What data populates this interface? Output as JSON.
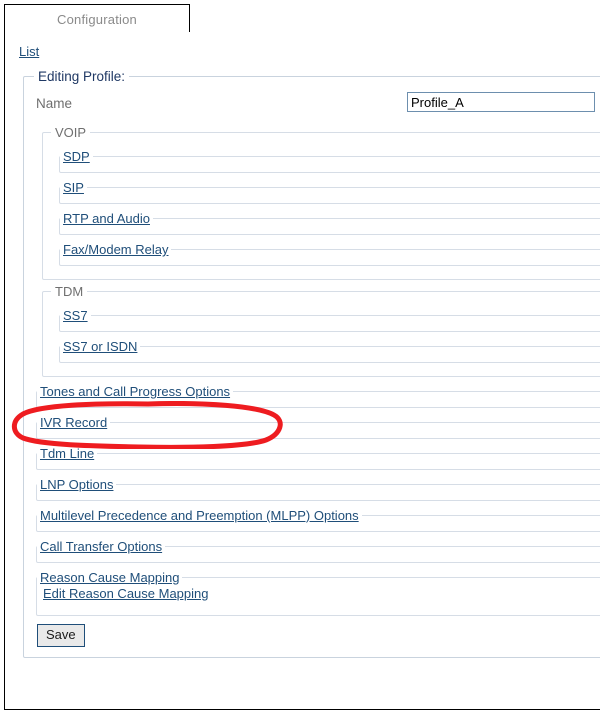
{
  "tab": {
    "label": "Configuration"
  },
  "breadcrumb": {
    "list_label": "List"
  },
  "form": {
    "legend": "Editing Profile:",
    "name_label": "Name",
    "name_value": "Profile_A",
    "name_placeholder": "",
    "save_label": "Save"
  },
  "sections": {
    "voip": {
      "legend": "VOIP",
      "items": [
        {
          "label": "SDP"
        },
        {
          "label": "SIP"
        },
        {
          "label": "RTP and Audio"
        },
        {
          "label": "Fax/Modem Relay"
        }
      ]
    },
    "tdm": {
      "legend": "TDM",
      "items": [
        {
          "label": "SS7"
        },
        {
          "label": "SS7 or ISDN"
        }
      ]
    }
  },
  "top_level_items": [
    {
      "label": "Tones and Call Progress Options"
    },
    {
      "label": "IVR Record"
    },
    {
      "label": "Tdm Line"
    },
    {
      "label": "LNP Options"
    },
    {
      "label": "Multilevel Precedence and Preemption (MLPP) Options"
    },
    {
      "label": "Call Transfer Options"
    }
  ],
  "reason_cause": {
    "legend": "Reason Cause Mapping",
    "edit_label": "Edit Reason Cause Mapping"
  },
  "annotation": {
    "color": "#ee1c20",
    "target": "Tones and Call Progress Options"
  },
  "colors": {
    "link": "#1f4e79",
    "legend_gray": "#6f6f6f",
    "heading": "#1f3864",
    "fieldset_border": "#d6dde6",
    "input_border": "#6d8fae",
    "annotation_red": "#ee1c20"
  }
}
